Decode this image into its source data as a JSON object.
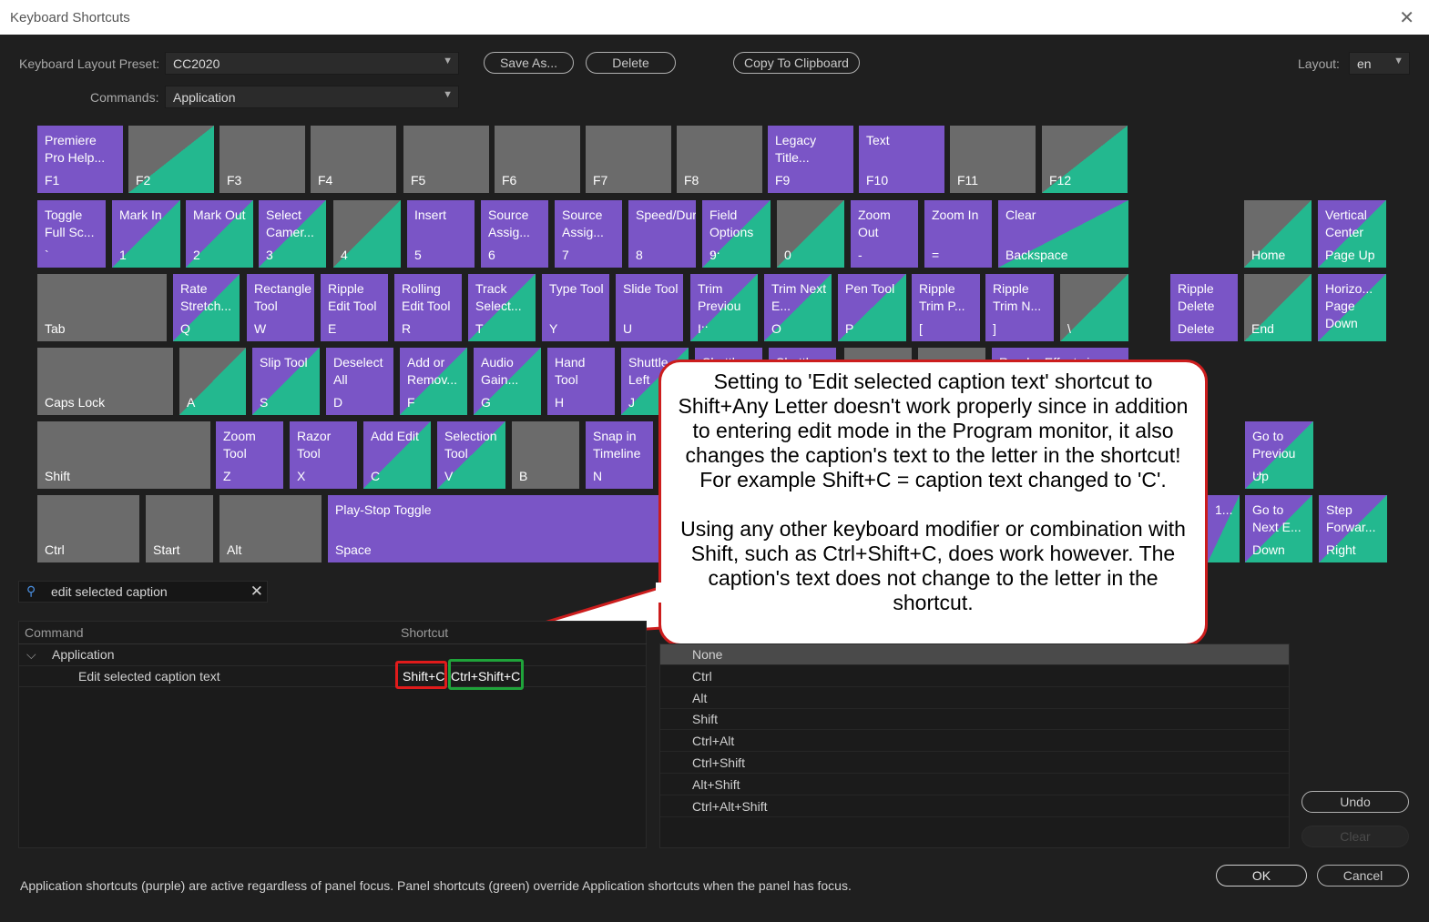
{
  "window": {
    "title": "Keyboard Shortcuts"
  },
  "icons": {
    "close": "close-icon",
    "search": "search-icon",
    "clear": "clear-icon",
    "collapse": "chevron-down-icon"
  },
  "colors": {
    "application": "#7a55c6",
    "panel": "#23b88f",
    "unassigned": "#6b6b6b",
    "callout_border": "#cc1d1d",
    "shortcut_red": "#e01b1b",
    "shortcut_green": "#1fa33a"
  },
  "toolbar": {
    "preset_label": "Keyboard Layout Preset:",
    "preset_value": "CC2020",
    "commands_label": "Commands:",
    "commands_value": "Application",
    "save_as": "Save As...",
    "delete": "Delete",
    "copy": "Copy To Clipboard",
    "layout_label": "Layout:",
    "layout_value": "en"
  },
  "keys": [
    {
      "cmd": "Premiere Pro Help...",
      "label": "F1",
      "state": "purple"
    },
    {
      "cmd": "",
      "label": "F2",
      "state": "gdiag"
    },
    {
      "cmd": "",
      "label": "F3",
      "state": "gray"
    },
    {
      "cmd": "",
      "label": "F4",
      "state": "gray"
    },
    {
      "cmd": "",
      "label": "F5",
      "state": "gray"
    },
    {
      "cmd": "",
      "label": "F6",
      "state": "gray"
    },
    {
      "cmd": "",
      "label": "F7",
      "state": "gray"
    },
    {
      "cmd": "",
      "label": "F8",
      "state": "gray"
    },
    {
      "cmd": "Legacy Title...",
      "label": "F9",
      "state": "purple"
    },
    {
      "cmd": "Text",
      "label": "F10",
      "state": "purple"
    },
    {
      "cmd": "",
      "label": "F11",
      "state": "gray"
    },
    {
      "cmd": "",
      "label": "F12",
      "state": "gdiag"
    },
    {
      "cmd": "Toggle Full Sc...",
      "label": "`",
      "state": "purple"
    },
    {
      "cmd": "Mark In",
      "label": "1",
      "state": "both"
    },
    {
      "cmd": "Mark Out",
      "label": "2",
      "state": "both"
    },
    {
      "cmd": "Select Camer...",
      "label": "3",
      "state": "both"
    },
    {
      "cmd": "",
      "label": "4",
      "state": "gdiag"
    },
    {
      "cmd": "Insert",
      "label": "5",
      "state": "purple"
    },
    {
      "cmd": "Source Assig...",
      "label": "6",
      "state": "purple"
    },
    {
      "cmd": "Source Assig...",
      "label": "7",
      "state": "purple"
    },
    {
      "cmd": "Speed/Duration...",
      "label": "8",
      "state": "purple"
    },
    {
      "cmd": "Field Options ...",
      "label": "9",
      "state": "both"
    },
    {
      "cmd": "",
      "label": "0",
      "state": "gdiag"
    },
    {
      "cmd": "Zoom Out",
      "label": "-",
      "state": "purple"
    },
    {
      "cmd": "Zoom In",
      "label": "=",
      "state": "purple"
    },
    {
      "cmd": "Clear",
      "label": "Backspace",
      "state": "both"
    },
    {
      "cmd": "",
      "label": "Home",
      "state": "gdiag"
    },
    {
      "cmd": "Vertical Center",
      "label": "Page Up",
      "state": "both"
    },
    {
      "cmd": "",
      "label": "Tab",
      "state": "gray"
    },
    {
      "cmd": "Rate Stretch...",
      "label": "Q",
      "state": "both"
    },
    {
      "cmd": "Rectangle Tool",
      "label": "W",
      "state": "purple"
    },
    {
      "cmd": "Ripple Edit Tool",
      "label": "E",
      "state": "purple"
    },
    {
      "cmd": "Rolling Edit Tool",
      "label": "R",
      "state": "purple"
    },
    {
      "cmd": "Track Select...",
      "label": "T",
      "state": "both"
    },
    {
      "cmd": "Type Tool",
      "label": "Y",
      "state": "purple"
    },
    {
      "cmd": "Slide Tool",
      "label": "U",
      "state": "purple"
    },
    {
      "cmd": "Trim Previou ...",
      "label": "I",
      "state": "both"
    },
    {
      "cmd": "Trim Next E...",
      "label": "O",
      "state": "both"
    },
    {
      "cmd": "Pen Tool",
      "label": "P",
      "state": "both"
    },
    {
      "cmd": "Ripple Trim P...",
      "label": "[",
      "state": "purple"
    },
    {
      "cmd": "Ripple Trim N...",
      "label": "]",
      "state": "purple"
    },
    {
      "cmd": "",
      "label": "\\",
      "state": "gdiag"
    },
    {
      "cmd": "Ripple Delete",
      "label": "Delete",
      "state": "purple"
    },
    {
      "cmd": "",
      "label": "End",
      "state": "gdiag"
    },
    {
      "cmd": "Horizo... Page Down",
      "label": "",
      "state": "both"
    },
    {
      "cmd": "",
      "label": "Caps Lock",
      "state": "gray"
    },
    {
      "cmd": "",
      "label": "A",
      "state": "gdiag"
    },
    {
      "cmd": "Slip Tool",
      "label": "S",
      "state": "both"
    },
    {
      "cmd": "Deselect All",
      "label": "D",
      "state": "purple"
    },
    {
      "cmd": "Add or Remov...",
      "label": "F",
      "state": "both"
    },
    {
      "cmd": "Audio Gain...",
      "label": "G",
      "state": "both"
    },
    {
      "cmd": "Hand Tool",
      "label": "H",
      "state": "purple"
    },
    {
      "cmd": "Shuttle Left",
      "label": "J",
      "state": "both"
    },
    {
      "cmd": "Shuttle",
      "label": "",
      "state": "purple"
    },
    {
      "cmd": "Shuttle",
      "label": "",
      "state": "purple"
    },
    {
      "cmd": "",
      "label": "",
      "state": "gray"
    },
    {
      "cmd": "",
      "label": "",
      "state": "gray"
    },
    {
      "cmd": "Render Effects in",
      "label": "",
      "state": "purple"
    },
    {
      "cmd": "",
      "label": "Shift",
      "state": "gray"
    },
    {
      "cmd": "Zoom Tool",
      "label": "Z",
      "state": "purple"
    },
    {
      "cmd": "Razor Tool",
      "label": "X",
      "state": "purple"
    },
    {
      "cmd": "Add Edit",
      "label": "C",
      "state": "both"
    },
    {
      "cmd": "Selection Tool",
      "label": "V",
      "state": "both"
    },
    {
      "cmd": "",
      "label": "B",
      "state": "gray"
    },
    {
      "cmd": "Snap in Timeline",
      "label": "N",
      "state": "purple"
    },
    {
      "cmd": "Go to Previou ...",
      "label": "Up",
      "state": "both"
    },
    {
      "cmd": "",
      "label": "Ctrl",
      "state": "gray"
    },
    {
      "cmd": "",
      "label": "Start",
      "state": "gray"
    },
    {
      "cmd": "",
      "label": "Alt",
      "state": "gray"
    },
    {
      "cmd": "Play-Stop Toggle",
      "label": "Space",
      "state": "purple"
    },
    {
      "cmd": "1...",
      "label": "",
      "state": "both"
    },
    {
      "cmd": "Go to Next E...",
      "label": "Down",
      "state": "both"
    },
    {
      "cmd": "Step Forwar...",
      "label": "Right",
      "state": "both"
    }
  ],
  "search": {
    "value": "edit selected caption"
  },
  "table": {
    "col_command": "Command",
    "col_shortcut": "Shortcut",
    "group": "Application",
    "item": "Edit selected caption text",
    "shortcut1": "Shift+C",
    "shortcut2": "Ctrl+Shift+C"
  },
  "modifiers": [
    "None",
    "Ctrl",
    "Alt",
    "Shift",
    "Ctrl+Alt",
    "Ctrl+Shift",
    "Alt+Shift",
    "Ctrl+Alt+Shift"
  ],
  "callout": {
    "p1": "Setting to 'Edit selected caption text' shortcut to Shift+Any Letter doesn't work properly since in addition to entering edit mode in the Program monitor, it also changes the caption's text to the letter in the shortcut!  For example Shift+C = caption text changed to 'C'.",
    "p2": "Using any other keyboard modifier or combination with Shift, such as Ctrl+Shift+C, does work however.  The caption's text does not change to the letter in the shortcut."
  },
  "buttons": {
    "undo": "Undo",
    "clear": "Clear",
    "ok": "OK",
    "cancel": "Cancel"
  },
  "footer": "Application shortcuts (purple) are active regardless of panel focus. Panel shortcuts (green) override Application shortcuts when the panel has focus."
}
